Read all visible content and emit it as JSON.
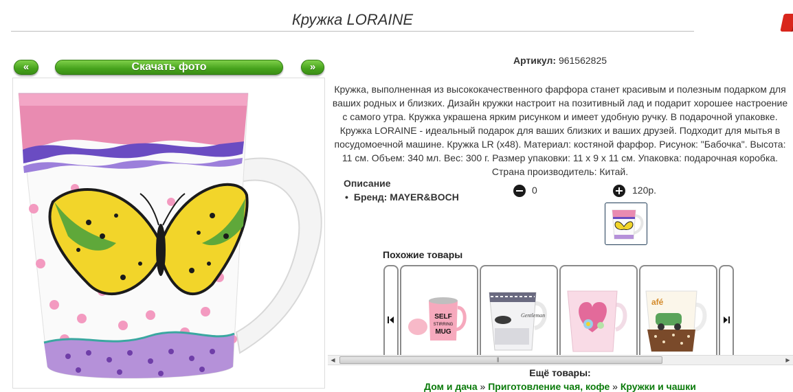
{
  "product": {
    "title": "Кружка LORAINE",
    "article_label": "Артикул:",
    "article_value": "961562825",
    "description": "Кружка, выполненная из высококачественного фарфора станет красивым и полезным подарком для ваших родных и близких. Дизайн кружки настроит на позитивный лад и подарит хорошее настроение с самого утра. Кружка украшена ярким рисунком и имеет удобную ручку. В подарочной упаковке. Кружка LORAINE - идеальный подарок для ваших близких и ваших друзей. Подходит для мытья в посудомоечной машине. Кружка LR (x48). Материал: костяной фарфор. Рисунок: \"Бабочка\". Высота: 11 см. Объем: 340 мл. Вес: 300 г. Размер упаковки: 11 х 9 х 11 см. Упаковка: подарочная коробка. Страна производитель: Китай."
  },
  "toolbar": {
    "prev_label": "«",
    "download_label": "Скачать фото",
    "next_label": "»"
  },
  "specs": {
    "title": "Описание",
    "items": [
      "Бренд: MAYER&BOCH"
    ]
  },
  "cart": {
    "quantity": "0",
    "price": "120р."
  },
  "similar": {
    "title": "Похожие товары",
    "items": [
      {
        "name": "self-stirring-mug",
        "text": "SELF STIRRING MUG"
      },
      {
        "name": "gentleman-mug"
      },
      {
        "name": "heart-flower-mug"
      },
      {
        "name": "cafe-car-mug"
      }
    ]
  },
  "more": {
    "title": "Ещё товары:",
    "crumbs": [
      "Дом и дача",
      "Приготовление чая, кофе",
      "Кружки и чашки"
    ],
    "separator": "»"
  },
  "icons": {
    "close": "close-icon",
    "minus": "minus-circle-icon",
    "plus": "plus-circle-icon"
  },
  "colors": {
    "accent_green": "#46a21c",
    "close_red": "#d9261c",
    "link_green": "#0a7a0a"
  }
}
